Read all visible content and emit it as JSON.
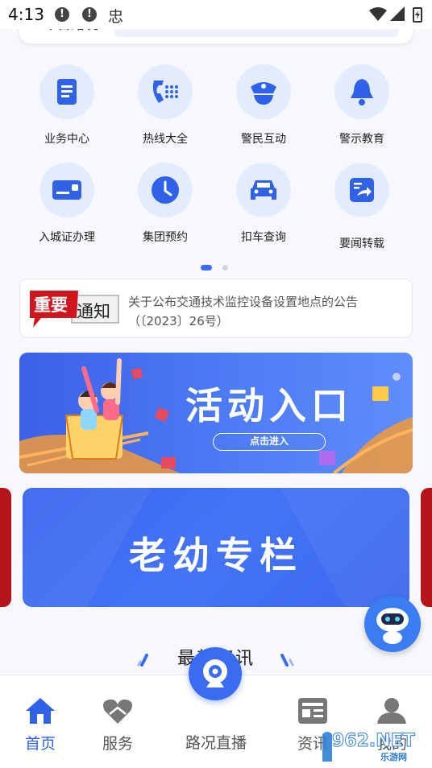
{
  "status_bar": {
    "time": "4:13",
    "alert1": "!",
    "alert2": "!",
    "app_glyph": "忠"
  },
  "traffic": {
    "label": "今日路况："
  },
  "services": [
    {
      "label": "业务中心",
      "icon": "document-icon"
    },
    {
      "label": "热线大全",
      "icon": "phone-icon"
    },
    {
      "label": "警民互动",
      "icon": "police-cap-icon"
    },
    {
      "label": "警示教育",
      "icon": "bell-icon"
    },
    {
      "label": "入城证办理",
      "icon": "id-card-icon"
    },
    {
      "label": "集团预约",
      "icon": "clock-icon"
    },
    {
      "label": "扣车查询",
      "icon": "car-icon"
    },
    {
      "label": "要闻转载",
      "icon": "share-icon"
    }
  ],
  "notice": {
    "tag_red": "重要",
    "tag_white": "通知",
    "text": "关于公布交通技术监控设备设置地点的公告（〔2023〕26号）"
  },
  "activity": {
    "title": "活动入口",
    "button": "点击进入"
  },
  "elder": {
    "title": "老幼专栏"
  },
  "news": {
    "title": "最新资讯"
  },
  "nav": {
    "home": "首页",
    "service": "服务",
    "live": "路况直播",
    "info": "资讯",
    "mine": "我的"
  },
  "watermark": {
    "text": "962.NET",
    "sub": "乐游网"
  },
  "colors": {
    "primary": "#3a6cf2",
    "icon_bg": "#e3ecfd",
    "accent_red": "#d0161d"
  }
}
